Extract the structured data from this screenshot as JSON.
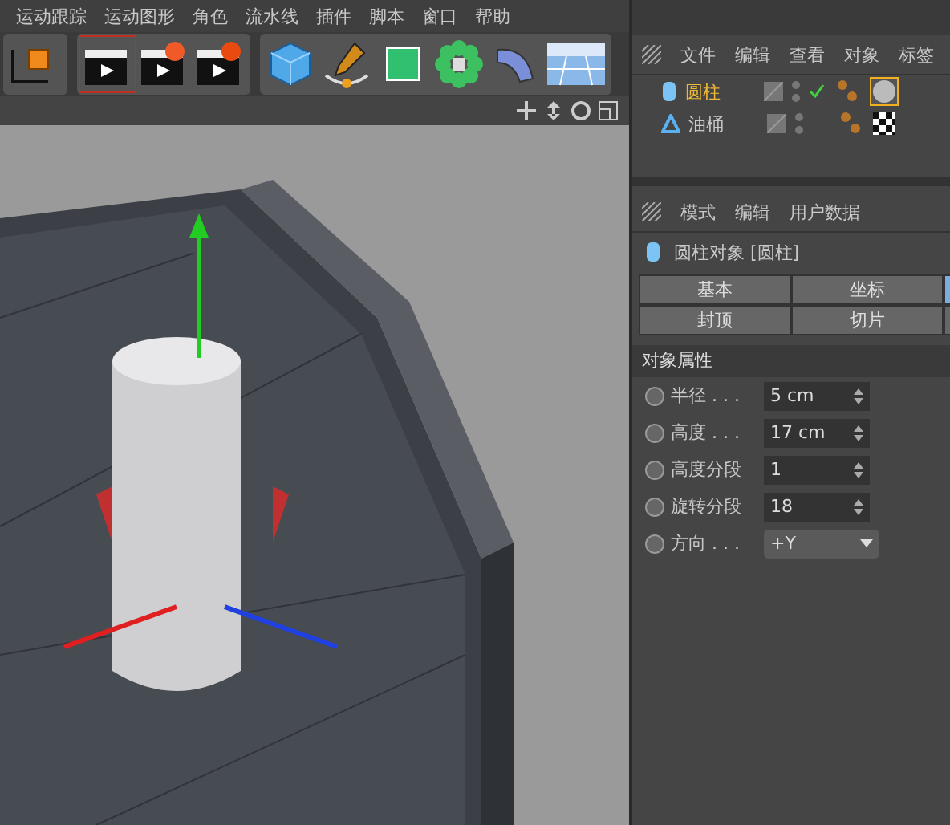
{
  "menu_bar": [
    "运动跟踪",
    "运动图形",
    "角色",
    "流水线",
    "插件",
    "脚本",
    "窗口",
    "帮助"
  ],
  "object_manager": {
    "menu": [
      "文件",
      "编辑",
      "查看",
      "对象",
      "标签"
    ],
    "objects": [
      {
        "name": "圆柱",
        "kind": "cylinder",
        "selected": true,
        "checked": true
      },
      {
        "name": "油桶",
        "kind": "null",
        "selected": false,
        "checked": false
      }
    ]
  },
  "attribute_manager": {
    "menu": [
      "模式",
      "编辑",
      "用户数据"
    ],
    "object_title": "圆柱对象 [圆柱]",
    "tabs": [
      [
        {
          "label": "基本",
          "selected": false
        },
        {
          "label": "坐标",
          "selected": false
        },
        {
          "selected": true
        }
      ],
      [
        {
          "label": "封顶",
          "selected": false
        },
        {
          "label": "切片",
          "selected": false
        },
        {
          "selected": false
        }
      ]
    ],
    "section": "对象属性",
    "fields": [
      {
        "label": "半径 . . .",
        "kind": "number",
        "value": "5 cm",
        "checked": false
      },
      {
        "label": "高度 . . .",
        "kind": "number",
        "value": "17 cm",
        "checked": false
      },
      {
        "label": "高度分段",
        "kind": "number",
        "value": "1",
        "checked": false
      },
      {
        "label": "旋转分段",
        "kind": "number",
        "value": "18",
        "checked": false
      },
      {
        "label": "方向 . . .",
        "kind": "dropdown",
        "value": "+Y",
        "checked": false
      }
    ]
  }
}
